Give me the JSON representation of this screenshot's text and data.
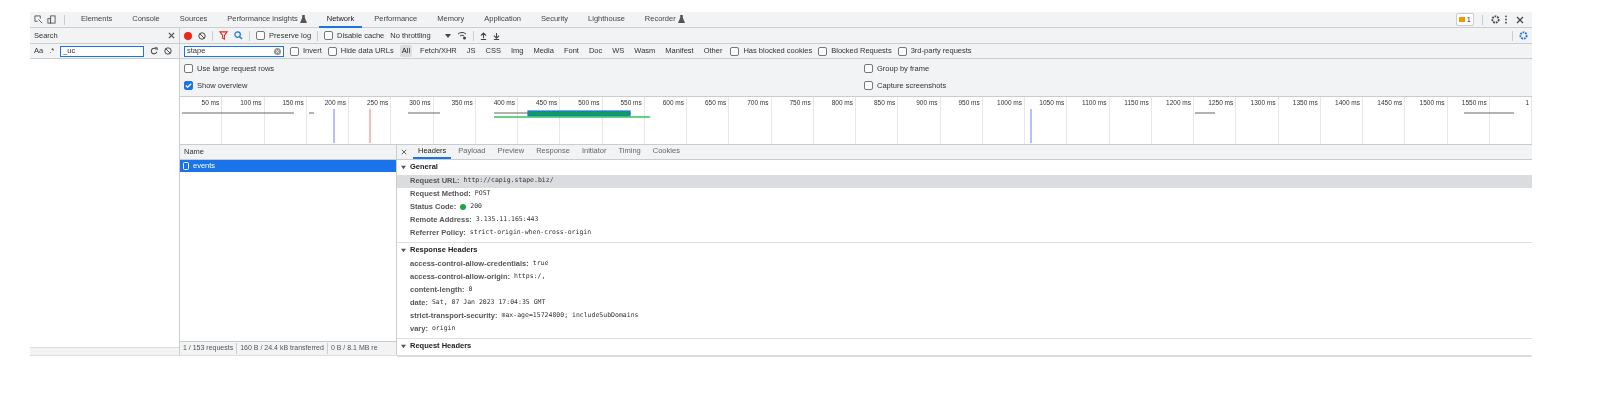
{
  "tabs": [
    {
      "label": "Elements",
      "selected": false,
      "experimental": false
    },
    {
      "label": "Console",
      "selected": false,
      "experimental": false
    },
    {
      "label": "Sources",
      "selected": false,
      "experimental": false
    },
    {
      "label": "Performance insights",
      "selected": false,
      "experimental": true
    },
    {
      "label": "Network",
      "selected": true,
      "experimental": false
    },
    {
      "label": "Performance",
      "selected": false,
      "experimental": false
    },
    {
      "label": "Memory",
      "selected": false,
      "experimental": false
    },
    {
      "label": "Application",
      "selected": false,
      "experimental": false
    },
    {
      "label": "Security",
      "selected": false,
      "experimental": false
    },
    {
      "label": "Lighthouse",
      "selected": false,
      "experimental": false
    },
    {
      "label": "Recorder",
      "selected": false,
      "experimental": true
    }
  ],
  "issues_badge": "1",
  "search_panel": {
    "title": "Search",
    "case_toggle": "Aa",
    "regex_toggle": ".*",
    "query": "_uc"
  },
  "toolbar": {
    "recording": true,
    "preserve_log": {
      "label": "Preserve log",
      "checked": false
    },
    "disable_cache": {
      "label": "Disable cache",
      "checked": false
    },
    "throttling": "No throttling"
  },
  "filter": {
    "value": "stape",
    "invert": {
      "label": "Invert",
      "checked": false
    },
    "hide_data_urls": {
      "label": "Hide data URLs",
      "checked": false
    },
    "types": [
      {
        "label": "All",
        "selected": true
      },
      {
        "label": "Fetch/XHR",
        "selected": false
      },
      {
        "label": "JS",
        "selected": false
      },
      {
        "label": "CSS",
        "selected": false
      },
      {
        "label": "Img",
        "selected": false
      },
      {
        "label": "Media",
        "selected": false
      },
      {
        "label": "Font",
        "selected": false
      },
      {
        "label": "Doc",
        "selected": false
      },
      {
        "label": "WS",
        "selected": false
      },
      {
        "label": "Wasm",
        "selected": false
      },
      {
        "label": "Manifest",
        "selected": false
      },
      {
        "label": "Other",
        "selected": false
      }
    ],
    "extra": [
      {
        "label": "Has blocked cookies",
        "checked": false
      },
      {
        "label": "Blocked Requests",
        "checked": false
      },
      {
        "label": "3rd-party requests",
        "checked": false
      }
    ]
  },
  "options": [
    {
      "label": "Use large request rows",
      "checked": false
    },
    {
      "label": "Group by frame",
      "checked": false
    },
    {
      "label": "Show overview",
      "checked": true
    },
    {
      "label": "Capture screenshots",
      "checked": false
    }
  ],
  "timeline_ticks": [
    "50 ms",
    "100 ms",
    "150 ms",
    "200 ms",
    "250 ms",
    "300 ms",
    "350 ms",
    "400 ms",
    "450 ms",
    "500 ms",
    "550 ms",
    "600 ms",
    "650 ms",
    "700 ms",
    "750 ms",
    "800 ms",
    "850 ms",
    "900 ms",
    "950 ms",
    "1000 ms",
    "1050 ms",
    "1100 ms",
    "1150 ms",
    "1200 ms",
    "1250 ms",
    "1300 ms",
    "1350 ms",
    "1400 ms",
    "1450 ms",
    "1500 ms",
    "1550 ms",
    "1"
  ],
  "requests": {
    "column": "Name",
    "rows": [
      {
        "name": "events",
        "selected": true
      }
    ]
  },
  "status_bar": [
    "1 / 153 requests",
    "160 B / 24.4 kB transferred",
    "0 B / 8.1 MB re"
  ],
  "detail_tabs": [
    {
      "label": "Headers",
      "selected": true
    },
    {
      "label": "Payload",
      "selected": false
    },
    {
      "label": "Preview",
      "selected": false
    },
    {
      "label": "Response",
      "selected": false
    },
    {
      "label": "Initiator",
      "selected": false
    },
    {
      "label": "Timing",
      "selected": false
    },
    {
      "label": "Cookies",
      "selected": false
    }
  ],
  "sections": [
    {
      "title": "General",
      "expanded": true,
      "rows": [
        {
          "name": "Request URL:",
          "value": "http://capig.stape.biz/",
          "selected": true
        },
        {
          "name": "Request Method:",
          "value": "POST",
          "selected": false
        },
        {
          "name": "Status Code:",
          "value": "200",
          "selected": false,
          "color": "#1ea446"
        },
        {
          "name": "Remote Address:",
          "value": "3.135.11.165:443",
          "selected": false
        },
        {
          "name": "Referrer Policy:",
          "value": "strict-origin-when-cross-origin",
          "selected": false
        }
      ]
    },
    {
      "title": "Response Headers",
      "expanded": true,
      "rows": [
        {
          "name": "access-control-allow-credentials:",
          "value": "true",
          "selected": false
        },
        {
          "name": "access-control-allow-origin:",
          "value": "https:/,",
          "selected": false
        },
        {
          "name": "content-length:",
          "value": "0",
          "selected": false
        },
        {
          "name": "date:",
          "value": "Sat, 07 Jan 2023 17:04:35 GMT",
          "selected": false
        },
        {
          "name": "strict-transport-security:",
          "value": "max-age=15724800; includeSubDomains",
          "selected": false
        },
        {
          "name": "vary:",
          "value": "origin",
          "selected": false
        }
      ]
    },
    {
      "title": "Request Headers",
      "expanded": true
    }
  ]
}
